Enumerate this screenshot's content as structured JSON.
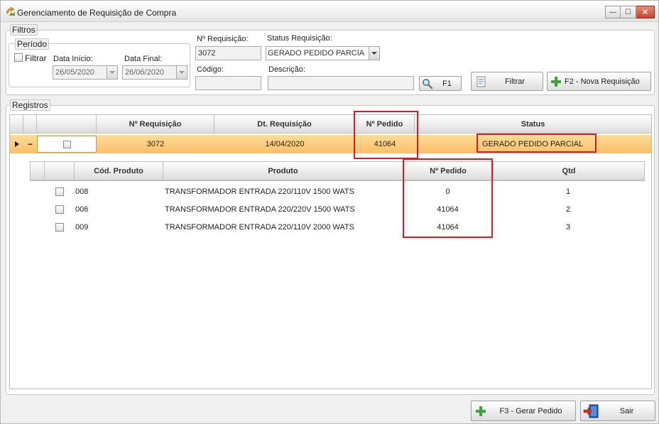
{
  "window": {
    "title": "Gerenciamento de Requisição de Compra",
    "min_glyph": "—",
    "max_glyph": "☐",
    "close_glyph": "✕"
  },
  "filters": {
    "legend": "Filtros",
    "period": {
      "legend": "Período",
      "filter_label": "Filtrar",
      "filter_checked": false,
      "start_label": "Data Início:",
      "start_value": "26/05/2020",
      "end_label": "Data Final:",
      "end_value": "26/06/2020"
    },
    "req_number_label": "Nº Requisição:",
    "req_number_value": "3072",
    "status_label": "Status Requisição:",
    "status_value": "GERADO PEDIDO PARCIA",
    "code_label": "Código:",
    "code_value": "",
    "description_label": "Descrição:",
    "description_value": "",
    "search_button": "F1",
    "filter_button": "Filtrar",
    "new_button": "F2 - Nova Requisição"
  },
  "registros": {
    "legend": "Registros",
    "columns": [
      "Nº Requisição",
      "Dt. Requisição",
      "Nº Pedido",
      "Status"
    ],
    "row": {
      "expand_glyph": "−",
      "req_number": "3072",
      "date": "14/04/2020",
      "order_number": "41064",
      "status": "GERADO PEDIDO PARCIAL"
    },
    "detail_columns": [
      "Cód. Produto",
      "Produto",
      "Nº Pedido",
      "Qtd"
    ],
    "detail_rows": [
      {
        "code": "008",
        "product": "TRANSFORMADOR ENTRADA 220/110V 1500 WATS",
        "order": "0",
        "qty": "1"
      },
      {
        "code": "006",
        "product": "TRANSFORMADOR ENTRADA 220/220V 1500 WATS",
        "order": "41064",
        "qty": "2"
      },
      {
        "code": "009",
        "product": "TRANSFORMADOR ENTRADA 220/110V 2000 WATS",
        "order": "41064",
        "qty": "3"
      }
    ]
  },
  "footer": {
    "generate_button": "F3 - Gerar Pedido",
    "exit_button": "Sair"
  },
  "colors": {
    "selected_row": "#fdc77a",
    "highlight": "#d0202a",
    "plus_green": "#3aa63a"
  }
}
